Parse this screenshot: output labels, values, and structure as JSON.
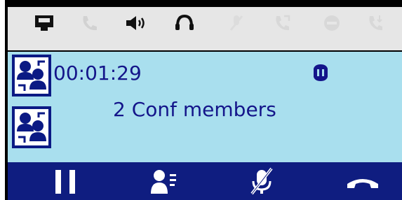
{
  "status_icons": [
    {
      "name": "network-icon",
      "active": true
    },
    {
      "name": "handset-icon",
      "active": false
    },
    {
      "name": "speaker-icon",
      "active": true
    },
    {
      "name": "headset-icon",
      "active": true
    },
    {
      "name": "mute-icon",
      "active": false
    },
    {
      "name": "call-forward-icon",
      "active": false
    },
    {
      "name": "do-not-disturb-icon",
      "active": false
    },
    {
      "name": "transfer-icon",
      "active": false
    }
  ],
  "call": {
    "duration": "00:01:29",
    "members_text": "2 Conf members"
  },
  "softkeys": [
    {
      "name": "hold-icon"
    },
    {
      "name": "participants-icon"
    },
    {
      "name": "mute-mic-icon"
    },
    {
      "name": "hangup-icon"
    }
  ],
  "colors": {
    "screen_bg": "#a9dfee",
    "text": "#14158a",
    "softkey_bar": "#0f1d80",
    "statusbar_bg": "#e6e6e6"
  }
}
